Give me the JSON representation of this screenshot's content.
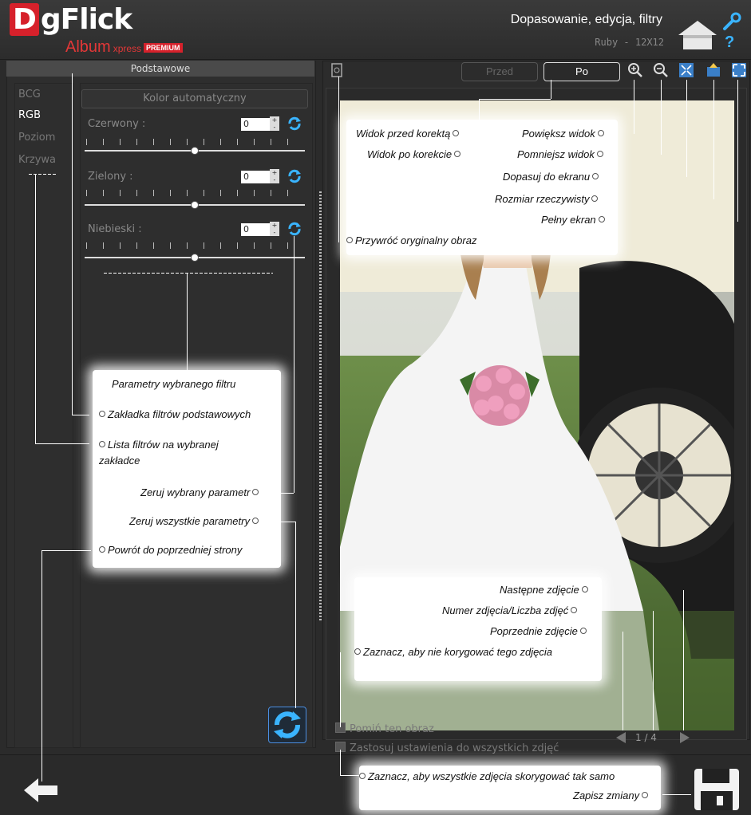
{
  "header": {
    "logo_letter": "D",
    "logo_word": "gFlick",
    "logo_sub": "Album",
    "logo_xpress": "xpress",
    "logo_premium": "PREMIUM",
    "title": "Dopasowanie, edycja, filtry",
    "subtitle": "Ruby - 12X12"
  },
  "icons": {
    "home": "home-icon",
    "settings": "wrench-icon",
    "help": "?"
  },
  "left_panel": {
    "tab_label": "Podstawowe",
    "filters": [
      "BCG",
      "RGB",
      "Poziom",
      "Krzywa"
    ],
    "active_filter": "RGB",
    "auto_color_label": "Kolor automatyczny",
    "params": [
      {
        "label": "Czerwony :",
        "value": "0",
        "level": 0.5
      },
      {
        "label": "Zielony :",
        "value": "0",
        "level": 0.5
      },
      {
        "label": "Niebieski :",
        "value": "0",
        "level": 0.5
      }
    ],
    "spin_up": "+",
    "spin_down": "-"
  },
  "viewer": {
    "before_label": "Przed",
    "after_label": "Po",
    "counter": "1 / 4"
  },
  "footer": {
    "skip_label": "Pomiń ten obraz",
    "apply_all_label": "Zastosuj ustawienia do wszystkich zdjęć"
  },
  "callouts": {
    "params_filter": "Parametry wybranego filtru",
    "basic_tab": "Zakładka filtrów podstawowych",
    "filter_list": "Lista filtrów na wybranej zakładce",
    "reset_param": "Zeruj wybrany parametr",
    "reset_all": "Zeruj wszystkie parametry",
    "back": "Powrót do poprzedniej strony",
    "before_view": "Widok przed korektą",
    "after_view": "Widok po korekcie",
    "zoom_in": "Powiększ widok",
    "zoom_out": "Pomniejsz widok",
    "fit": "Dopasuj do ekranu",
    "actual_size": "Rozmiar rzeczywisty",
    "fullscreen": "Pełny ekran",
    "restore": "Przywróć oryginalny obraz",
    "next": "Następne zdjęcie",
    "number": "Numer zdjęcia/Liczba zdjęć",
    "prev": "Poprzednie zdjęcie",
    "skip": "Zaznacz, aby nie korygować tego zdjęcia",
    "apply_all": "Zaznacz, aby wszystkie zdjęcia skorygować tak samo",
    "save": "Zapisz zmiany"
  }
}
